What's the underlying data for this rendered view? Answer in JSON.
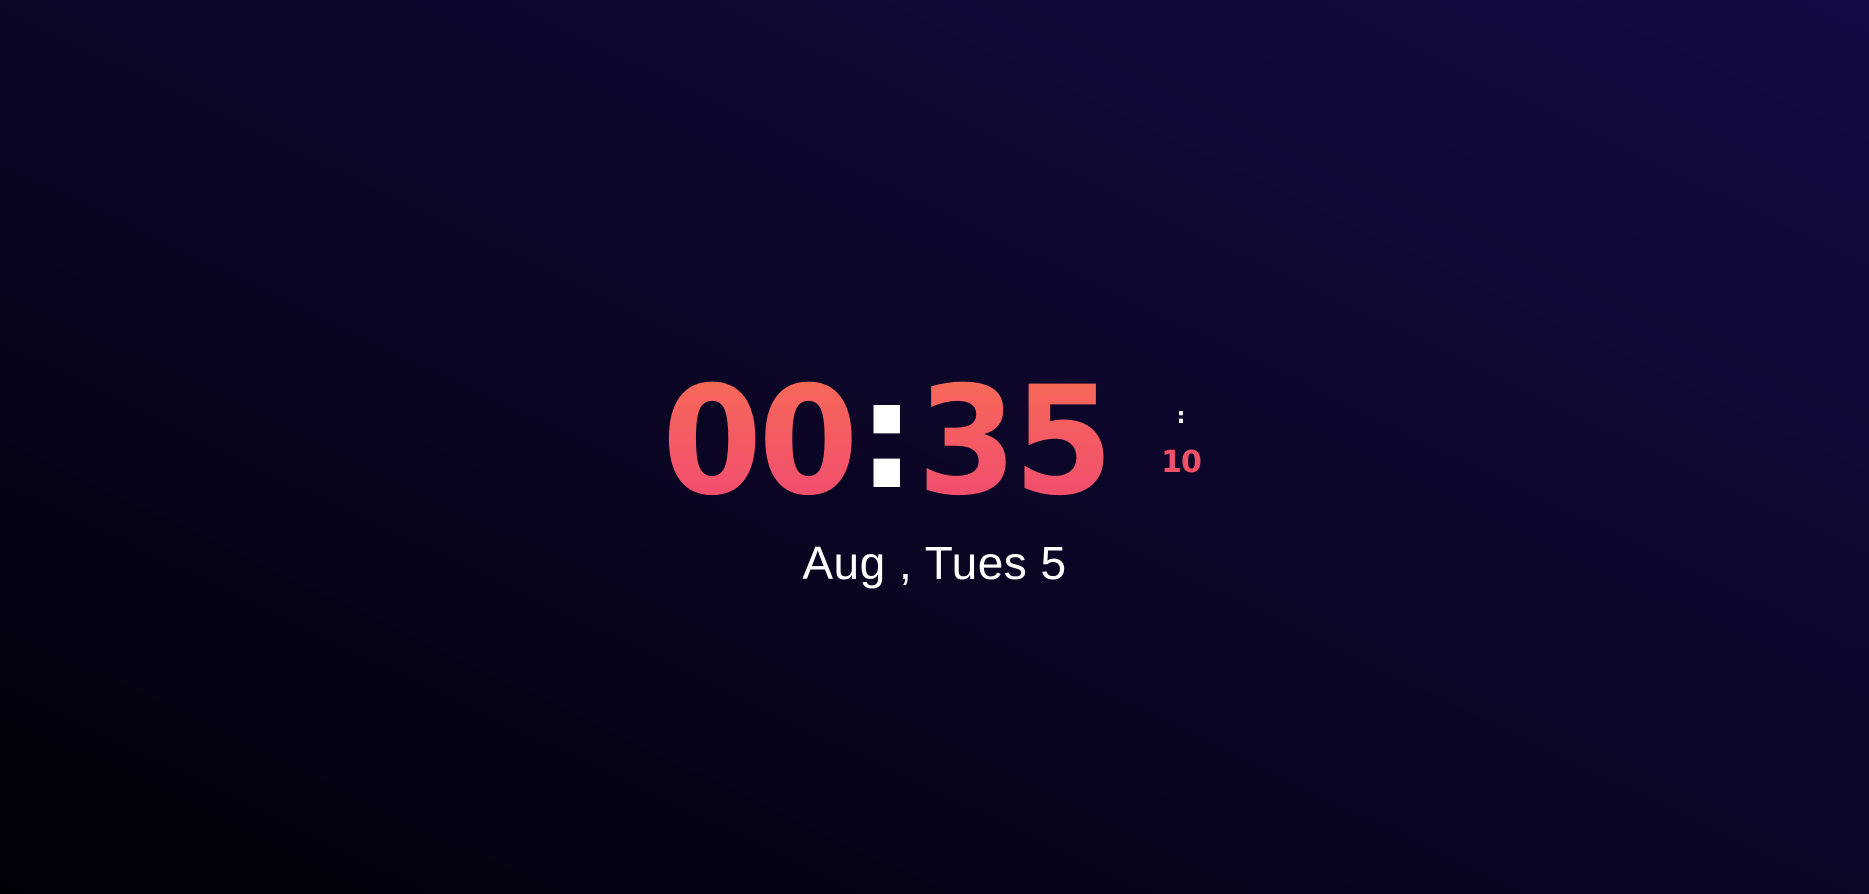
{
  "clock": {
    "hours": "00",
    "separator": ":",
    "minutes": "35",
    "seconds_separator": ":",
    "seconds": "10"
  },
  "date": {
    "text": "Aug , Tues 5"
  },
  "colors": {
    "background_dark": "#020007",
    "background_light": "#150a44",
    "digits_top": "#f76b55",
    "digits_bottom": "#f04a72",
    "separator": "#ffffff",
    "date_text": "#ffffff"
  }
}
